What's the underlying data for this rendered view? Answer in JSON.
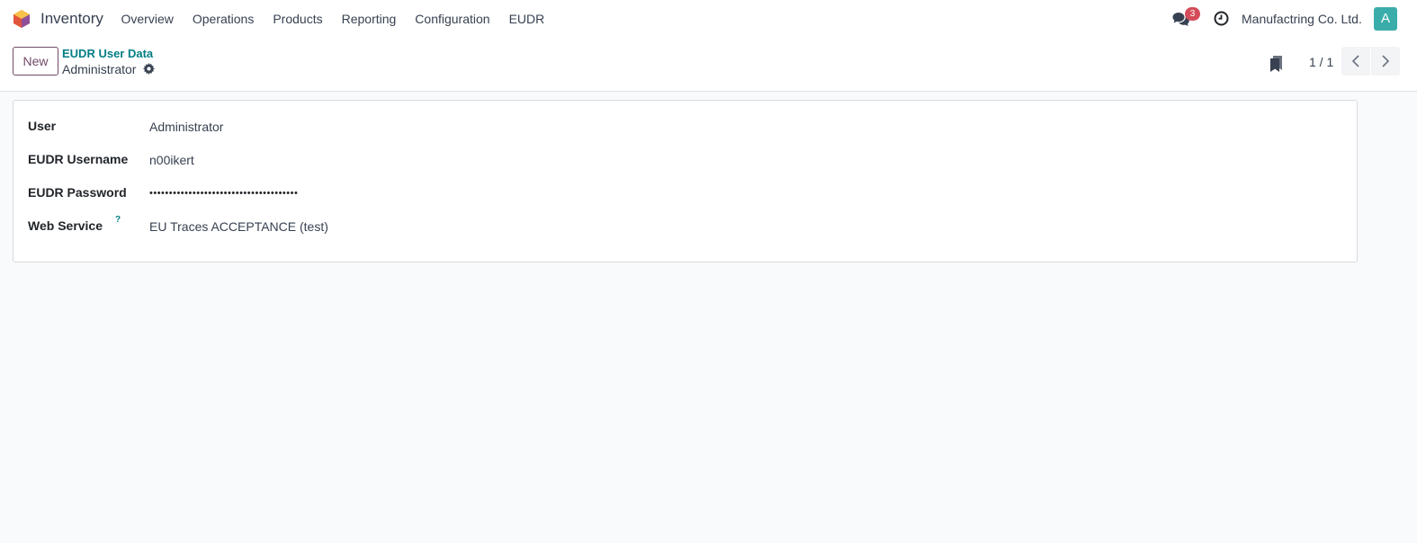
{
  "navbar": {
    "app_name": "Inventory",
    "menu": [
      "Overview",
      "Operations",
      "Products",
      "Reporting",
      "Configuration",
      "EUDR"
    ],
    "messages_badge": "3",
    "company": "Manufactring Co. Ltd.",
    "avatar_letter": "A"
  },
  "control_panel": {
    "new_label": "New",
    "breadcrumb": "EUDR User Data",
    "record_name": "Administrator",
    "pager_value": "1 / 1"
  },
  "form": {
    "fields": [
      {
        "label": "User",
        "value": "Administrator"
      },
      {
        "label": "EUDR Username",
        "value": "n00ikert"
      },
      {
        "label": "EUDR Password",
        "value": "••••••••••••••••••••••••••••••••••••••"
      },
      {
        "label": "Web Service",
        "value": "EU Traces ACCEPTANCE (test)",
        "help": "?"
      }
    ]
  },
  "colors": {
    "brand": "#714b67",
    "accent": "#017e84",
    "avatar": "#3aadaa",
    "badge": "#d44c59"
  }
}
